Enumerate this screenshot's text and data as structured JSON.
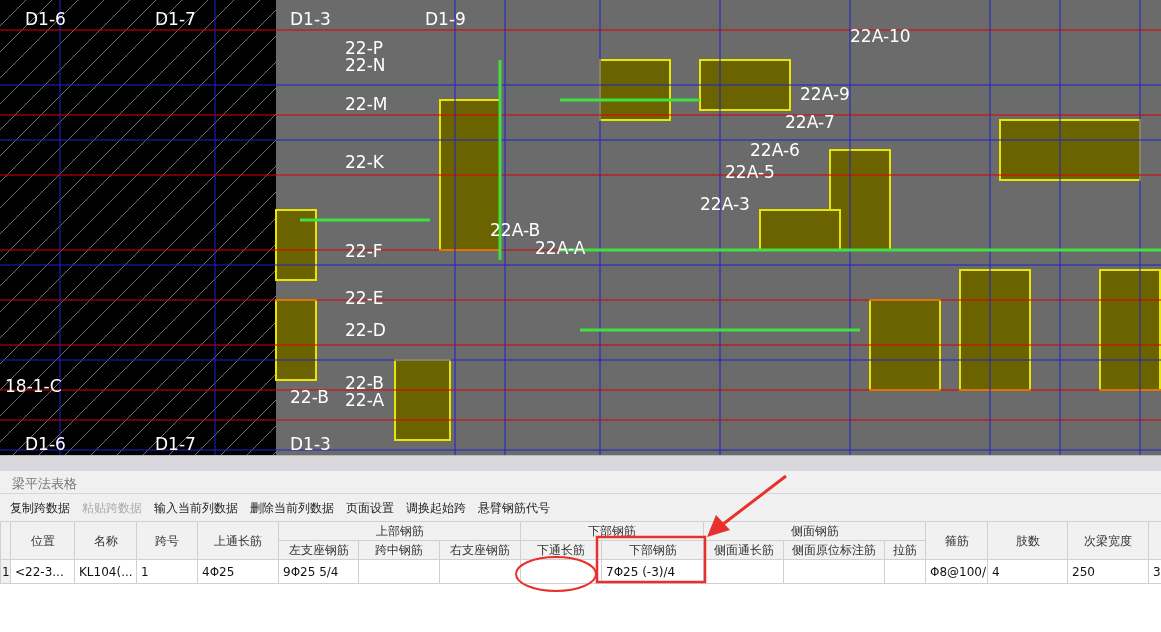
{
  "cad_view": {
    "grid_labels": [
      "D1-6",
      "D1-7",
      "D1-3",
      "D1-9",
      "22-P",
      "22-N",
      "22-M",
      "22-K",
      "22-F",
      "22-E",
      "22-D",
      "22-B",
      "22-A",
      "22-B",
      "22A-10",
      "22A-9",
      "22A-7",
      "22A-6",
      "22A-5",
      "22A-3",
      "22A-A",
      "22A-B",
      "18-1-C",
      "D1-6",
      "D1-7",
      "D1-3"
    ]
  },
  "panel": {
    "title": "梁平法表格",
    "toolbar": [
      {
        "label": "复制跨数据",
        "disabled": false
      },
      {
        "label": "粘贴跨数据",
        "disabled": true
      },
      {
        "label": "输入当前列数据",
        "disabled": false
      },
      {
        "label": "删除当前列数据",
        "disabled": false
      },
      {
        "label": "页面设置",
        "disabled": false
      },
      {
        "label": "调换起始跨",
        "disabled": false
      },
      {
        "label": "悬臂钢筋代号",
        "disabled": false
      }
    ],
    "table": {
      "header": [
        {
          "label": "位置"
        },
        {
          "label": "名称"
        },
        {
          "label": "跨号"
        },
        {
          "label": "上通长筋"
        },
        {
          "label": "上部钢筋",
          "columns": [
            "左支座钢筋",
            "跨中钢筋",
            "右支座钢筋"
          ]
        },
        {
          "label": "下部钢筋",
          "columns": [
            "下通长筋",
            "下部钢筋"
          ]
        },
        {
          "label": "侧面钢筋",
          "columns": [
            "侧面通长筋",
            "侧面原位标注筋",
            "拉筋"
          ]
        },
        {
          "label": "箍筋"
        },
        {
          "label": "肢数"
        },
        {
          "label": "次梁宽度"
        }
      ],
      "rows": [
        {
          "number": "1",
          "cells": [
            "<22-3...",
            "KL104(...",
            "1",
            "4Φ25",
            "9Φ25 5/4",
            null,
            null,
            null,
            "7Φ25 (-3)/4",
            null,
            null,
            null,
            "Φ8@100/",
            "4",
            "250",
            "3"
          ]
        }
      ]
    },
    "annotations": [
      {
        "kind": "circle"
      },
      {
        "kind": "rectangle"
      },
      {
        "kind": "arrow"
      }
    ]
  }
}
